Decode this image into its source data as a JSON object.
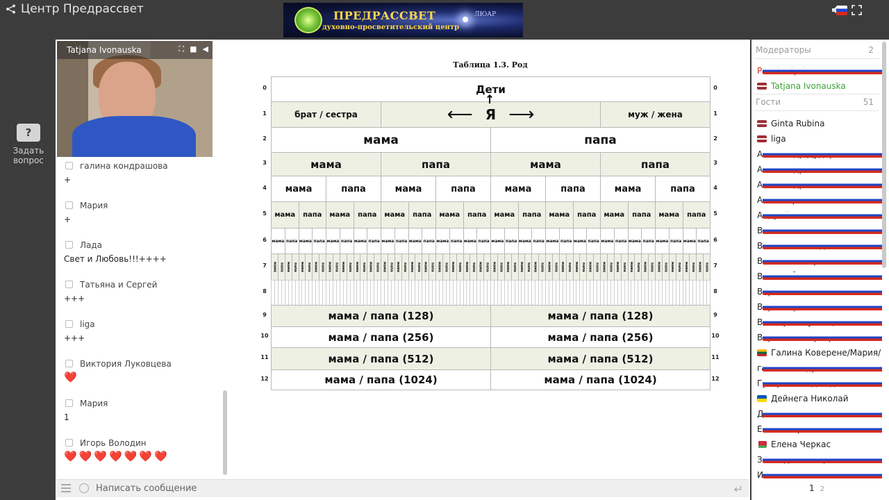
{
  "app": {
    "title": "Центр Предрассвет"
  },
  "banner": {
    "line1": "ПРЕДРАССВЕТ",
    "line2": "духовно-просветительский центр",
    "line3": "ЛЮАР"
  },
  "ask": {
    "label": "Задать вопрос"
  },
  "video": {
    "name": "Tatjana Ivonauska"
  },
  "chat": {
    "messages": [
      {
        "author": "галина кондрашова",
        "text": "+"
      },
      {
        "author": "Мария",
        "text": "+"
      },
      {
        "author": "Лада",
        "text": "Свет и Любовь!!!++++"
      },
      {
        "author": "Татьяна и Сергей",
        "text": "+++"
      },
      {
        "author": "liga",
        "text": "+++"
      },
      {
        "author": "Виктория Луковцева",
        "text": "❤️"
      },
      {
        "author": "Мария",
        "text": "1"
      },
      {
        "author": "Игорь Володин",
        "text": "❤️❤️❤️❤️❤️❤️❤️"
      }
    ],
    "input_placeholder": "Написать сообщение"
  },
  "table": {
    "caption": "Таблица 1.3. Род",
    "children": "Дети",
    "ya": "Я",
    "left_arrow": "⟵",
    "right_arrow": "⟶",
    "up_arrow": "↑",
    "siblings": "брат / сестра",
    "spouse": "муж / жена",
    "mama": "мама",
    "papa": "папа",
    "r9": "мама / папа (128)",
    "r10": "мама / папа (256)",
    "r11": "мама / папа (512)",
    "r12": "мама / папа (1024)",
    "row_numbers": [
      "0",
      "1",
      "2",
      "3",
      "4",
      "5",
      "6",
      "7",
      "8",
      "9",
      "10",
      "11",
      "12"
    ]
  },
  "participants": {
    "moderators_label": "Модераторы",
    "moderators_count": "2",
    "moderators": [
      {
        "name": "Pavel Tulyakov",
        "flag": "ru",
        "color": "#d8281e"
      },
      {
        "name": "Tatjana Ivonauska",
        "flag": "lv",
        "color": "#3ca336"
      }
    ],
    "guests_label": "Гости",
    "guests_count": "51",
    "guests": [
      {
        "name": "Ginta Rubina",
        "flag": "lv"
      },
      {
        "name": "liga",
        "flag": "lv"
      },
      {
        "name": "Александр Дударов Элина ...",
        "flag": "ru"
      },
      {
        "name": "Александр.",
        "flag": "ru"
      },
      {
        "name": "Александр.",
        "flag": "ru"
      },
      {
        "name": "Алла Коренная",
        "flag": "ru"
      },
      {
        "name": "Андрей",
        "flag": "ru"
      },
      {
        "name": "Валентина Банникова",
        "flag": "ru"
      },
      {
        "name": "Валентина Мадилова",
        "flag": "ru"
      },
      {
        "name": "Валентина Прокопьева",
        "flag": "ru"
      },
      {
        "name": "ВАЛЕРИЙ ГАЛИМОВ",
        "flag": "ru"
      },
      {
        "name": "Вера",
        "flag": "ru"
      },
      {
        "name": "Вера Мария Хонякины",
        "flag": "ru"
      },
      {
        "name": "Виктория Луковцева",
        "flag": "ru"
      },
      {
        "name": "Воронова Маргарита",
        "flag": "ru"
      },
      {
        "name": "Галина Коверене/Мария/",
        "flag": "lt"
      },
      {
        "name": "галина кондрашова",
        "flag": "ru"
      },
      {
        "name": "Гусарова Надежда",
        "flag": "ru"
      },
      {
        "name": "Дейнега Николай",
        "flag": "ua"
      },
      {
        "name": "Джемма Моисеева",
        "flag": "ru"
      },
      {
        "name": "Елена Кириченко",
        "flag": "ru"
      },
      {
        "name": "Елена Черкас",
        "flag": "by"
      },
      {
        "name": "Зинаида Иванцова",
        "flag": "ru"
      },
      {
        "name": "Иван пачин",
        "flag": "ru"
      }
    ],
    "page_current": "1",
    "page_next": "2"
  }
}
